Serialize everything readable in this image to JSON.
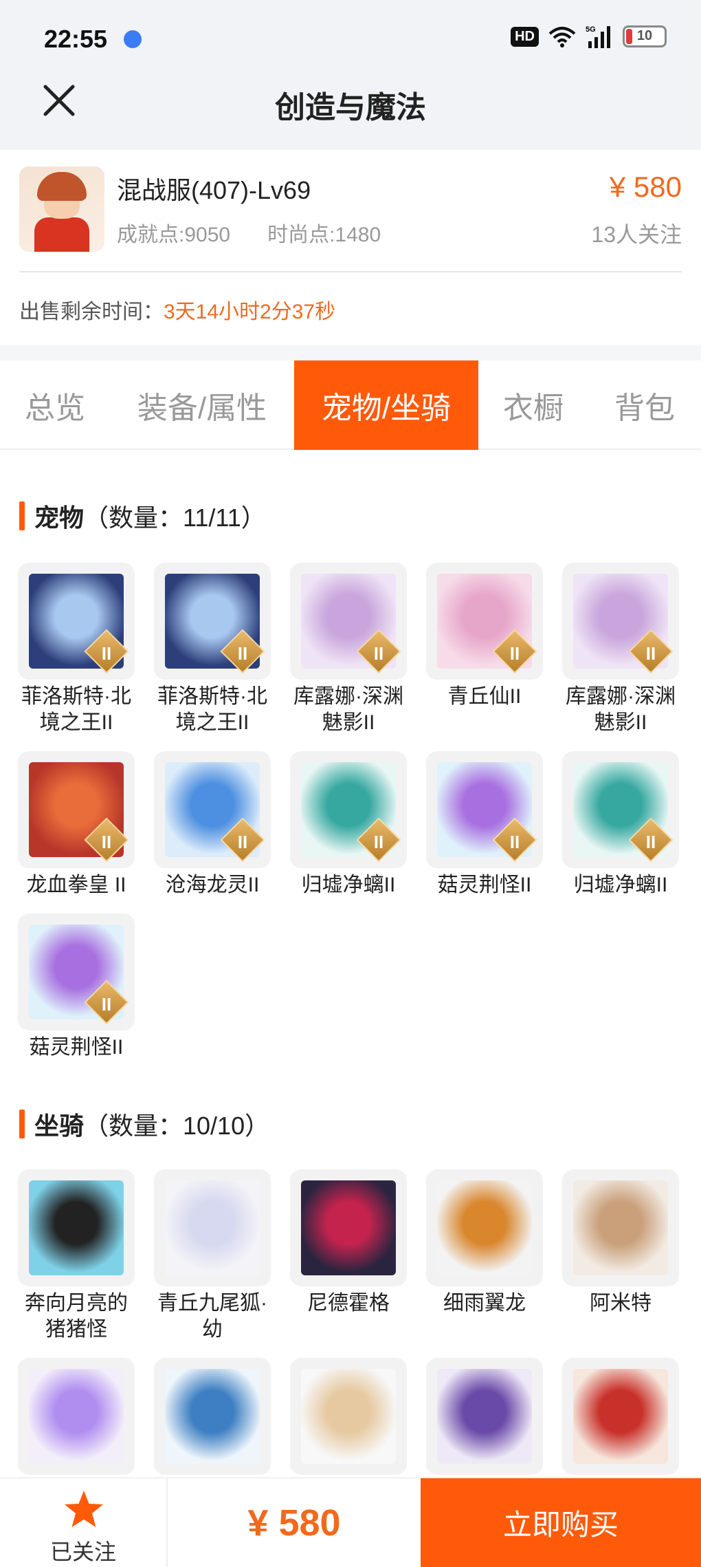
{
  "status_bar": {
    "time": "22:55",
    "hd": "HD",
    "signal": "5G",
    "battery": "10"
  },
  "header": {
    "title": "创造与魔法"
  },
  "product": {
    "name": "混战服(407)-Lv69",
    "achievement": "成就点:9050",
    "fashion": "时尚点:1480",
    "price": "¥ 580",
    "follow_count": "13人关注",
    "remain_label": "出售剩余时间：",
    "remain_value": "3天14小时2分37秒"
  },
  "tabs": [
    {
      "label": "总览",
      "active": false
    },
    {
      "label": "装备/属性",
      "active": false
    },
    {
      "label": "宠物/坐骑",
      "active": true
    },
    {
      "label": "衣橱",
      "active": false
    },
    {
      "label": "背包",
      "active": false
    }
  ],
  "pets": {
    "title": "宠物",
    "count": "（数量：11/11）",
    "items": [
      {
        "name": "菲洛斯特·北境之王II",
        "art": "#2c3f7a",
        "art2": "#a9c8f0",
        "tier": "II"
      },
      {
        "name": "菲洛斯特·北境之王II",
        "art": "#2c3f7a",
        "art2": "#a9c8f0",
        "tier": "II"
      },
      {
        "name": "库露娜·深渊魅影II",
        "art": "#efe4f5",
        "art2": "#c8a5dc",
        "tier": "II"
      },
      {
        "name": "青丘仙II",
        "art": "#f7dbe9",
        "art2": "#e6a6c9",
        "tier": "II"
      },
      {
        "name": "库露娜·深渊魅影II",
        "art": "#efe4f5",
        "art2": "#c8a5dc",
        "tier": "II"
      },
      {
        "name": "龙血拳皇 II",
        "art": "#b8352a",
        "art2": "#e86d3a",
        "tier": "II"
      },
      {
        "name": "沧海龙灵II",
        "art": "#dcecfb",
        "art2": "#4d8fe0",
        "tier": "II"
      },
      {
        "name": "归墟净螭II",
        "art": "#e8f6f4",
        "art2": "#36a8a0",
        "tier": "II"
      },
      {
        "name": "菇灵荆怪II",
        "art": "#dff1fb",
        "art2": "#a86fe0",
        "tier": "II"
      },
      {
        "name": "归墟净螭II",
        "art": "#e8f6f4",
        "art2": "#36a8a0",
        "tier": "II"
      },
      {
        "name": "菇灵荆怪II",
        "art": "#dff1fb",
        "art2": "#a86fe0",
        "tier": "II"
      }
    ]
  },
  "mounts": {
    "title": "坐骑",
    "count": "（数量：10/10）",
    "items": [
      {
        "name": "奔向月亮的猪猪怪",
        "art": "#7fd1e8",
        "art2": "#222222"
      },
      {
        "name": "青丘九尾狐·幼",
        "art": "#f4f4f8",
        "art2": "#d6d9ef"
      },
      {
        "name": "尼德霍格",
        "art": "#2b2440",
        "art2": "#c4234e"
      },
      {
        "name": "细雨翼龙",
        "art": "#f3f3f3",
        "art2": "#d9862d"
      },
      {
        "name": "阿米特",
        "art": "#f2ebe3",
        "art2": "#c9a07a"
      },
      {
        "name": "",
        "art": "#f3eefa",
        "art2": "#b08ef0"
      },
      {
        "name": "",
        "art": "#eef5fb",
        "art2": "#3d7fc2"
      },
      {
        "name": "",
        "art": "#f8f8f8",
        "art2": "#e6c9a0"
      },
      {
        "name": "",
        "art": "#efe9f7",
        "art2": "#6a4aa8"
      },
      {
        "name": "",
        "art": "#f6e6dc",
        "art2": "#c8302a"
      }
    ]
  },
  "bottom_bar": {
    "follow_label": "已关注",
    "price": "¥ 580",
    "buy_label": "立即购买"
  },
  "colors": {
    "accent": "#ff5a0a",
    "price": "#f06a1d"
  }
}
